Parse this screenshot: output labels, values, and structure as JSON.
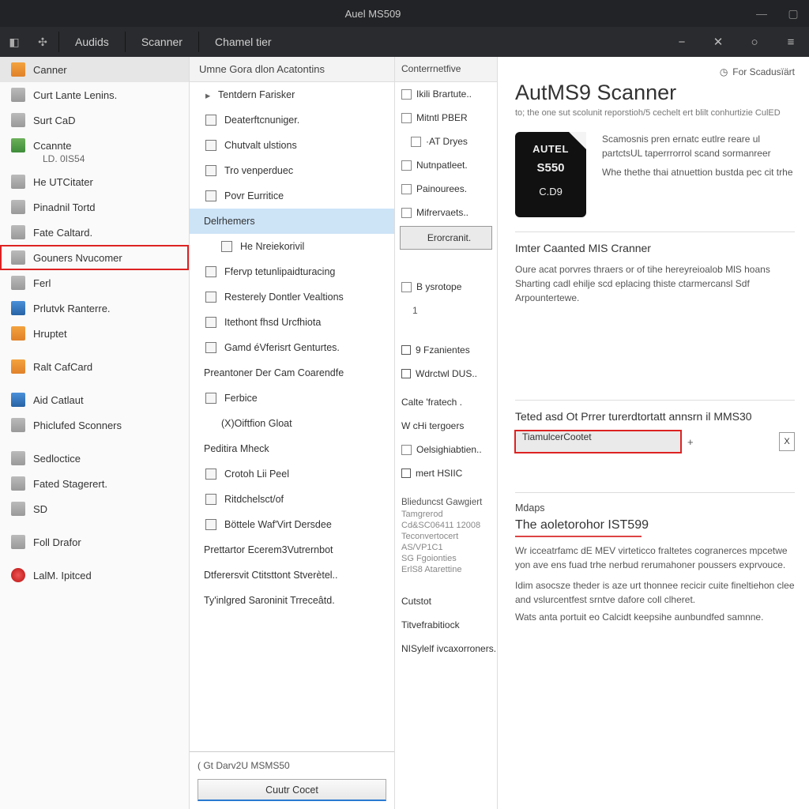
{
  "titlebar": {
    "title": "Auel MS509"
  },
  "menubar": {
    "items": [
      "Audids",
      "Scanner",
      "Chamel tier"
    ]
  },
  "nav": {
    "items": [
      {
        "label": "Canner",
        "icon": "o",
        "selected": true
      },
      {
        "label": "Curt Lante Lenins.",
        "icon": ""
      },
      {
        "label": "Surt CaD",
        "icon": ""
      },
      {
        "label": "Ccannte",
        "icon": "g",
        "sub": "LD. 0IS54"
      },
      {
        "label": "He UTCitater",
        "icon": ""
      },
      {
        "label": "Pinadnil Tortd",
        "icon": ""
      },
      {
        "label": "Fate Caltard.",
        "icon": ""
      },
      {
        "label": "Gouners Nvucomer",
        "icon": "",
        "highlight": true
      },
      {
        "label": "Ferl",
        "icon": ""
      },
      {
        "label": "Prlutvk Ranterre.",
        "icon": "b"
      },
      {
        "label": "Hruptet",
        "icon": "o"
      },
      {
        "label": "Ralt CafCard",
        "icon": "o",
        "gap": true
      },
      {
        "label": "Aid Catlaut",
        "icon": "b",
        "gap": true
      },
      {
        "label": "Phiclufed Sconners",
        "icon": ""
      },
      {
        "label": "Sedloctice",
        "icon": "",
        "gap": true
      },
      {
        "label": "Fated Stagerert.",
        "icon": ""
      },
      {
        "label": "SD",
        "icon": ""
      },
      {
        "label": "Foll Drafor",
        "icon": "",
        "gap": true
      },
      {
        "label": "LalM. Ipitced",
        "icon": "r",
        "gap": true
      }
    ]
  },
  "mid": {
    "header": "Umne Gora dlon Acatontins",
    "items": [
      {
        "label": "Tentdern Farisker",
        "arrow": true
      },
      {
        "label": "Deaterftcnuniger.",
        "icon": true
      },
      {
        "label": "Chutvalt ulstions",
        "icon": true
      },
      {
        "label": "Tro venperduec",
        "icon": true
      },
      {
        "label": "Povr Eurritice",
        "icon": true
      },
      {
        "label": "Delrhemers",
        "sel": true,
        "plain": true
      },
      {
        "label": "He Nreiekorivil",
        "sub": true,
        "icon": true
      },
      {
        "label": "Ffervp tetunlipaidturacing",
        "icon": true
      },
      {
        "label": "Resterely Dontler Vealtions",
        "icon": true
      },
      {
        "label": "Itethont fhsd Urcfhiota",
        "icon": true
      },
      {
        "label": "Gamd éVferisrt Genturtes.",
        "icon": true
      },
      {
        "label": "Preantoner Der Cam Coarendfe",
        "plain": true
      },
      {
        "label": "Ferbice",
        "icon": true
      },
      {
        "label": "(X)Oiftfion Gloat",
        "sub": true
      },
      {
        "label": "Peditira Mheck",
        "sub": true,
        "plain": true
      },
      {
        "label": "Crotoh Lii Peel",
        "icon": true
      },
      {
        "label": "Ritdchelsct/of",
        "icon": true
      },
      {
        "label": "Böttele Waf'Virt Dersdee",
        "icon": true
      },
      {
        "label": "Prettartor Ecerem3Vutrernbot",
        "plain": true
      },
      {
        "label": "Dtferersvit Ctitsttont Stverètel..",
        "plain": true
      },
      {
        "label": "Ty'inlgred Saroninit Trreceâtd.",
        "plain": true
      }
    ],
    "footer": {
      "label": "( Gt Darv2U MSMS50",
      "button": "Cuutr Cocet"
    }
  },
  "aux": {
    "header": "Conterrnetfive",
    "top": [
      {
        "label": "Ikili Brartute..",
        "icon": true
      },
      {
        "label": "Mitntl PBER",
        "icon": true
      },
      {
        "label": "·AT Dryes",
        "icon": true,
        "indent": true
      },
      {
        "label": "Nutnpatleet.",
        "icon": true
      },
      {
        "label": "Painourees.",
        "icon": true
      },
      {
        "label": "Mifrervaets..",
        "icon": true
      }
    ],
    "selbtn": "Erorcranit.",
    "b2": [
      {
        "label": "B ysrotope",
        "icon": true
      }
    ],
    "num": "1",
    "checks": [
      {
        "label": "9 Fzanientes"
      },
      {
        "label": "Wdrctwl DUS.."
      }
    ],
    "c3": [
      "Calte 'fratech .",
      "W cHi tergoers",
      {
        "label": "Oelsighiabtien..",
        "icon": true
      },
      {
        "label": "mert HSIIC",
        "cb": true
      }
    ],
    "sh1": "Blieduncst Gawgiert",
    "sm": [
      "Tamgrerod",
      "Cd&SC06411 12008",
      "Teconvertocert",
      "AS/VP1C1",
      "SG Fgoionties",
      "ErlS8 Atarettine"
    ],
    "tail": [
      "Cutstot",
      "Titvefrabitiock",
      "NISylelf ivcaxorroners."
    ]
  },
  "main": {
    "topLink": "For Scadusïärt",
    "h1": "AutMS9 Scanner",
    "subt": "to; the one sut scolunit reporstioh/5 cechelt ert blilt conhurtizie CulED",
    "card": {
      "l1": "AUTEL",
      "l2": "S550",
      "l3": "C.D9"
    },
    "heroText": [
      "Scamosnis pren ernatc eutlre reare ul partctsUL taperrrorrol scand sormanreer",
      "Whe thethe thai atnuettion bustda pec cit trhe"
    ],
    "sec1": {
      "h": "Imter Caanted MIS Cranner",
      "p1": "Oure acat porvres thraers or of tihe hereyreioalob MlS hoans",
      "p2": "Sharting cadl ehilje scd eplacing thiste ctarmercansl Sdf Arpountertewe."
    },
    "sec2": {
      "h": "Teted asd Ot Prrer turerdtortatt annsrn il MMS30",
      "input": "TiamulcerCootet"
    },
    "sec3": {
      "h": "Mdaps",
      "title": "The aoletorohor IST599",
      "p": [
        "Wr icceatrfamc dE MEV virteticco fraltetes cogranerces mpcetwe yon ave ens fuad trhe nerbud rerumahoner poussers exprvouce.",
        "Idim asocsze theder is aze urt thonnee recicir cuite fineltiehon clee and vslurcentfest srntve dafore coll clheret.",
        "Wats anta portuit eo Calcidt keepsihe aunbundfed samnne."
      ]
    }
  }
}
